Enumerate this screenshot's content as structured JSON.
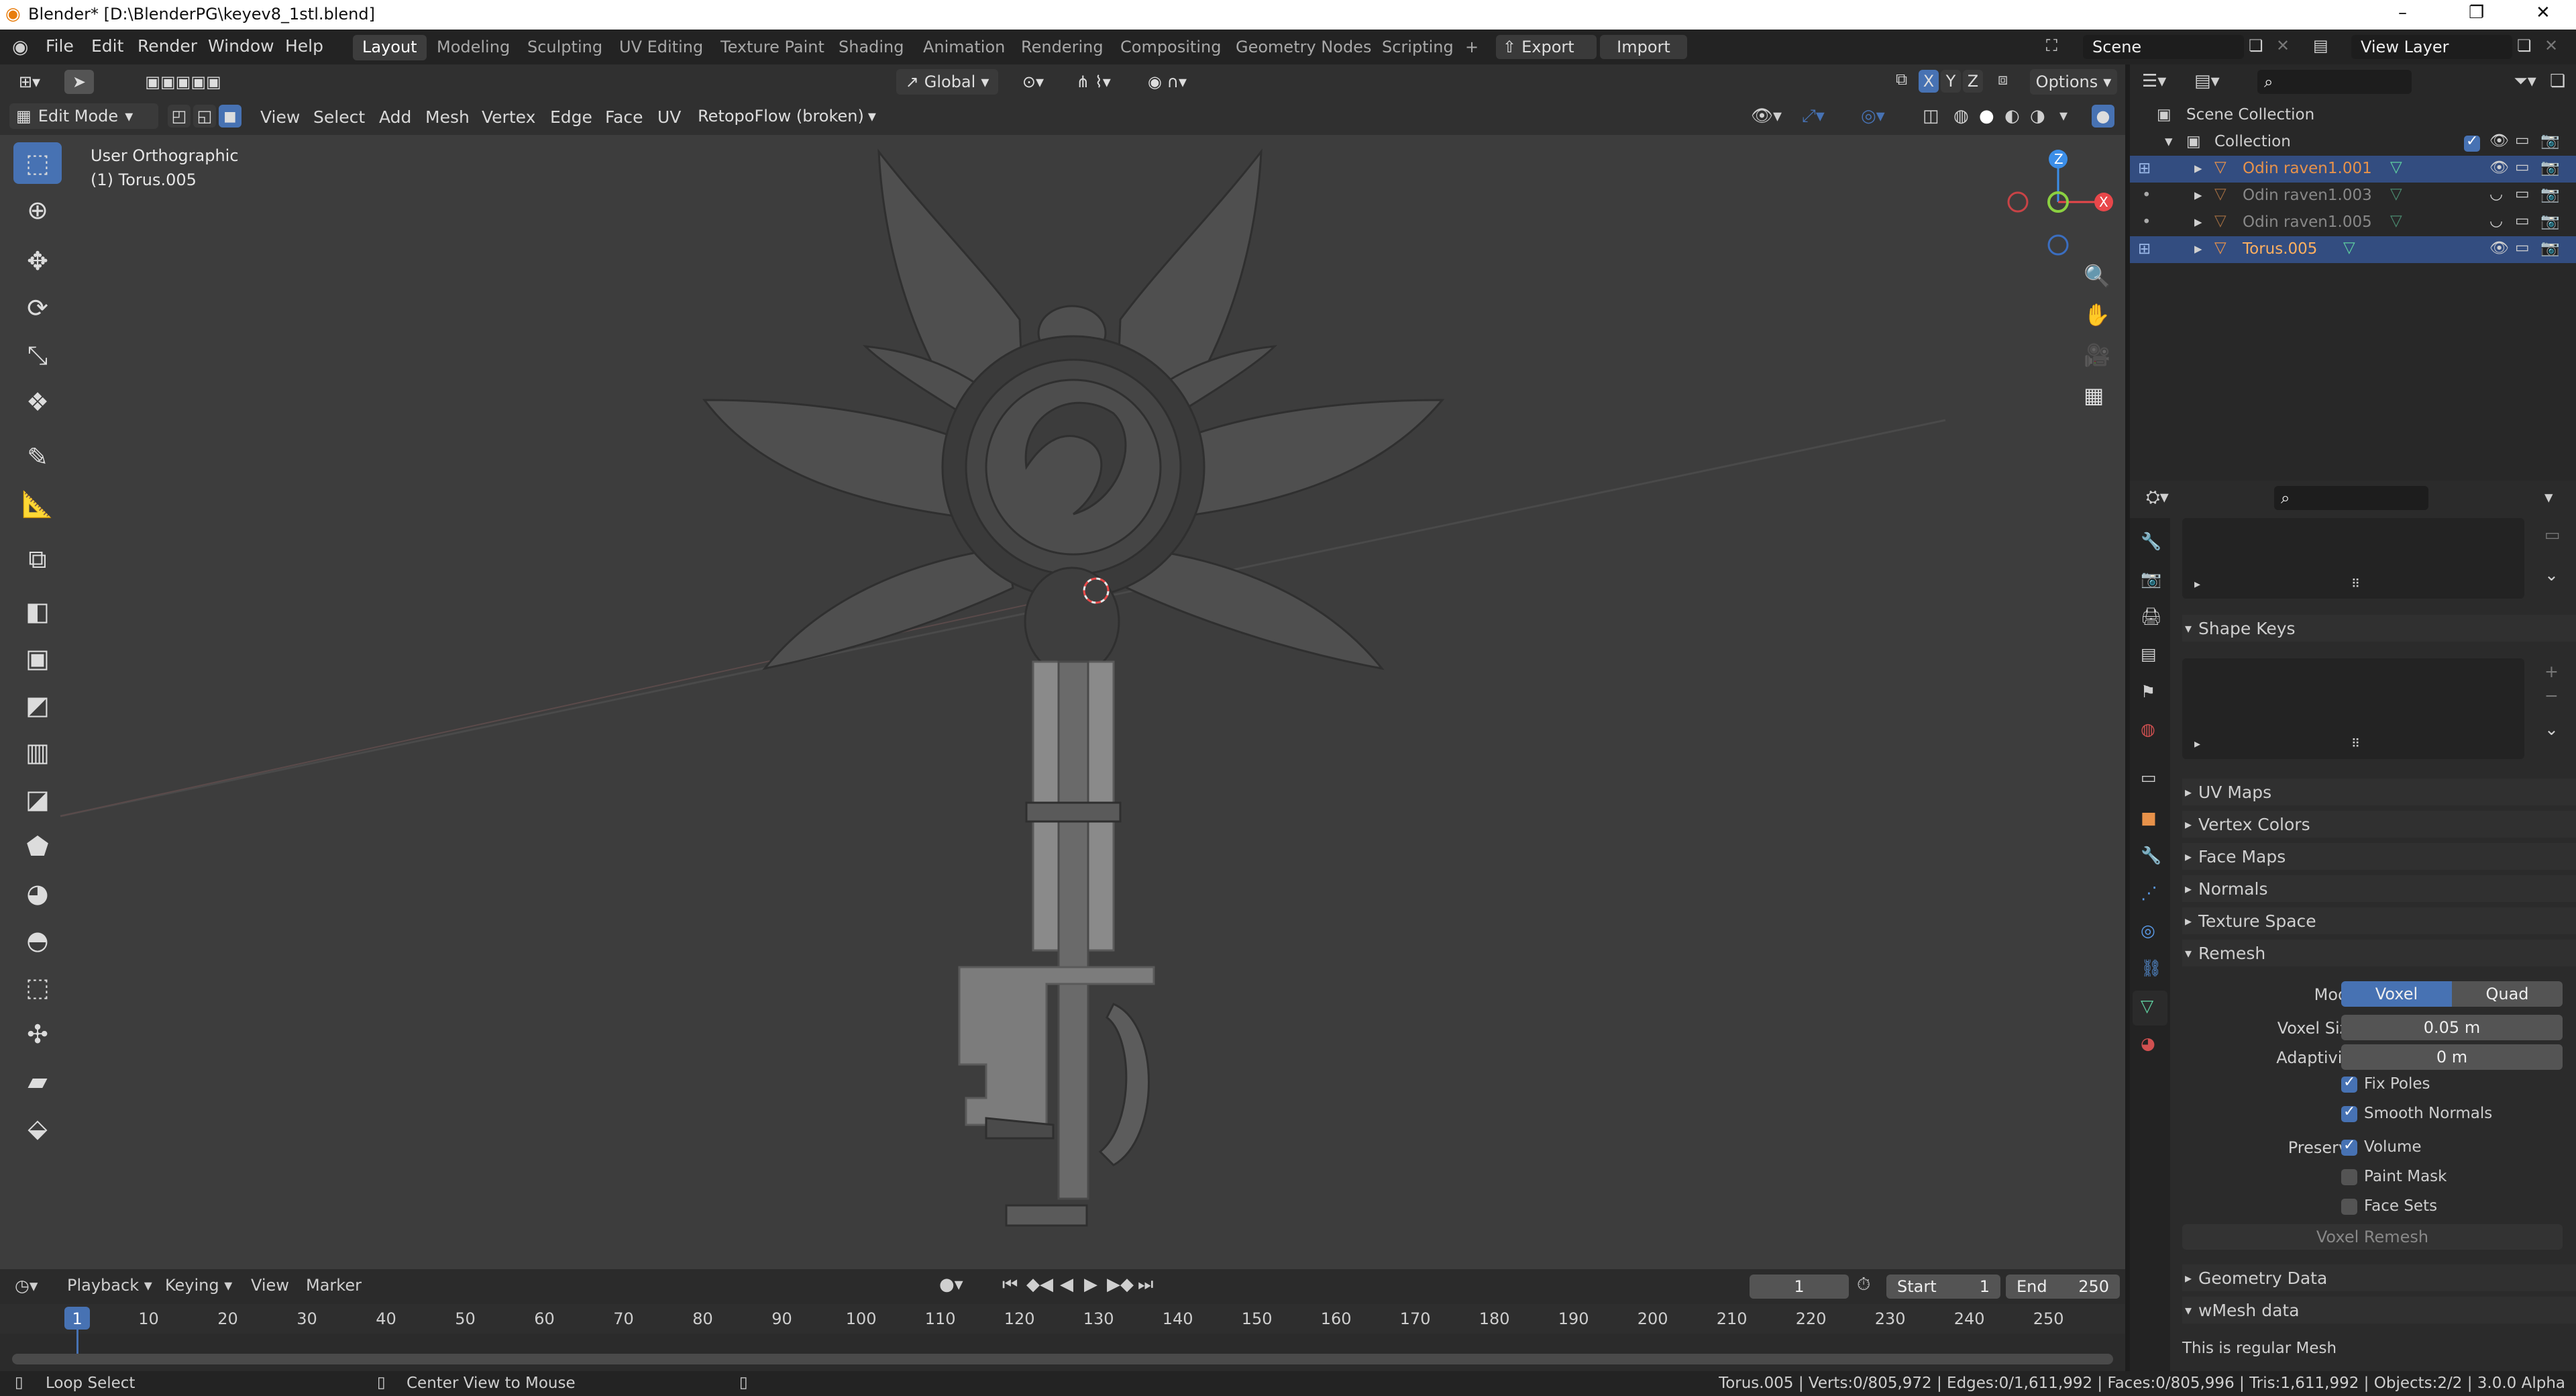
{
  "window": {
    "title": "Blender* [D:\\BlenderPG\\keyev8_1stl.blend]",
    "min": "–",
    "max": "❐",
    "close": "✕"
  },
  "menu": [
    "File",
    "Edit",
    "Render",
    "Window",
    "Help"
  ],
  "workspaces": [
    "Layout",
    "Modeling",
    "Sculpting",
    "UV Editing",
    "Texture Paint",
    "Shading",
    "Animation",
    "Rendering",
    "Compositing",
    "Geometry Nodes",
    "Scripting"
  ],
  "workspace_add": "+",
  "export_label": "Export",
  "import_label": "Import",
  "scene": "Scene",
  "view_layer": "View Layer",
  "vp_header": {
    "orientation": "Global",
    "options": "Options",
    "mode": "Edit Mode",
    "menus": [
      "View",
      "Select",
      "Add",
      "Mesh",
      "Vertex",
      "Edge",
      "Face",
      "UV"
    ],
    "retopo": "RetopoFlow (broken)"
  },
  "gizmo": {
    "x": "X",
    "y": "Y",
    "z": "Z"
  },
  "viewport": {
    "view_name": "User Orthographic",
    "object": "(1) Torus.005"
  },
  "outliner": {
    "scene_collection": "Scene Collection",
    "collection": "Collection",
    "items": [
      {
        "name": "Odin raven1.001",
        "sel": true
      },
      {
        "name": "Odin raven1.003",
        "sel": false
      },
      {
        "name": "Odin raven1.005",
        "sel": false
      },
      {
        "name": "Torus.005",
        "sel": true
      }
    ]
  },
  "props": {
    "shape_keys": "Shape Keys",
    "panels": [
      "UV Maps",
      "Vertex Colors",
      "Face Maps",
      "Normals",
      "Texture Space"
    ],
    "remesh": "Remesh",
    "mode_label": "Mode",
    "voxel": "Voxel",
    "quad": "Quad",
    "voxel_size_label": "Voxel Size",
    "voxel_size": "0.05 m",
    "adaptivity_label": "Adaptivity",
    "adaptivity": "0 m",
    "fix_poles": "Fix Poles",
    "smooth_normals": "Smooth Normals",
    "preserve_label": "Preserve",
    "volume": "Volume",
    "paint_mask": "Paint Mask",
    "face_sets": "Face Sets",
    "voxel_remesh": "Voxel Remesh",
    "geometry_data": "Geometry Data",
    "wmesh": "wMesh data",
    "regular_mesh": "This is regular Mesh"
  },
  "timeline": {
    "menus": [
      "Playback",
      "Keying",
      "View",
      "Marker"
    ],
    "current": "1",
    "start_label": "Start",
    "start": "1",
    "end_label": "End",
    "end": "250",
    "ticks": [
      "1",
      "10",
      "20",
      "30",
      "40",
      "50",
      "60",
      "70",
      "80",
      "90",
      "100",
      "110",
      "120",
      "130",
      "140",
      "150",
      "160",
      "170",
      "180",
      "190",
      "200",
      "210",
      "220",
      "230",
      "240",
      "250"
    ]
  },
  "status": {
    "left1": "Loop Select",
    "left2": "Center View to Mouse",
    "stats": "Torus.005 | Verts:0/805,972 | Edges:0/1,611,992 | Faces:0/805,996 | Tris:1,611,992 | Objects:2/2 | 3.0.0 Alpha"
  },
  "colors": {
    "accent": "#4772b3",
    "selected_row": "#334d80",
    "x_axis": "#e8474a",
    "y_axis": "#8bd141",
    "z_axis": "#3b8ee8"
  }
}
